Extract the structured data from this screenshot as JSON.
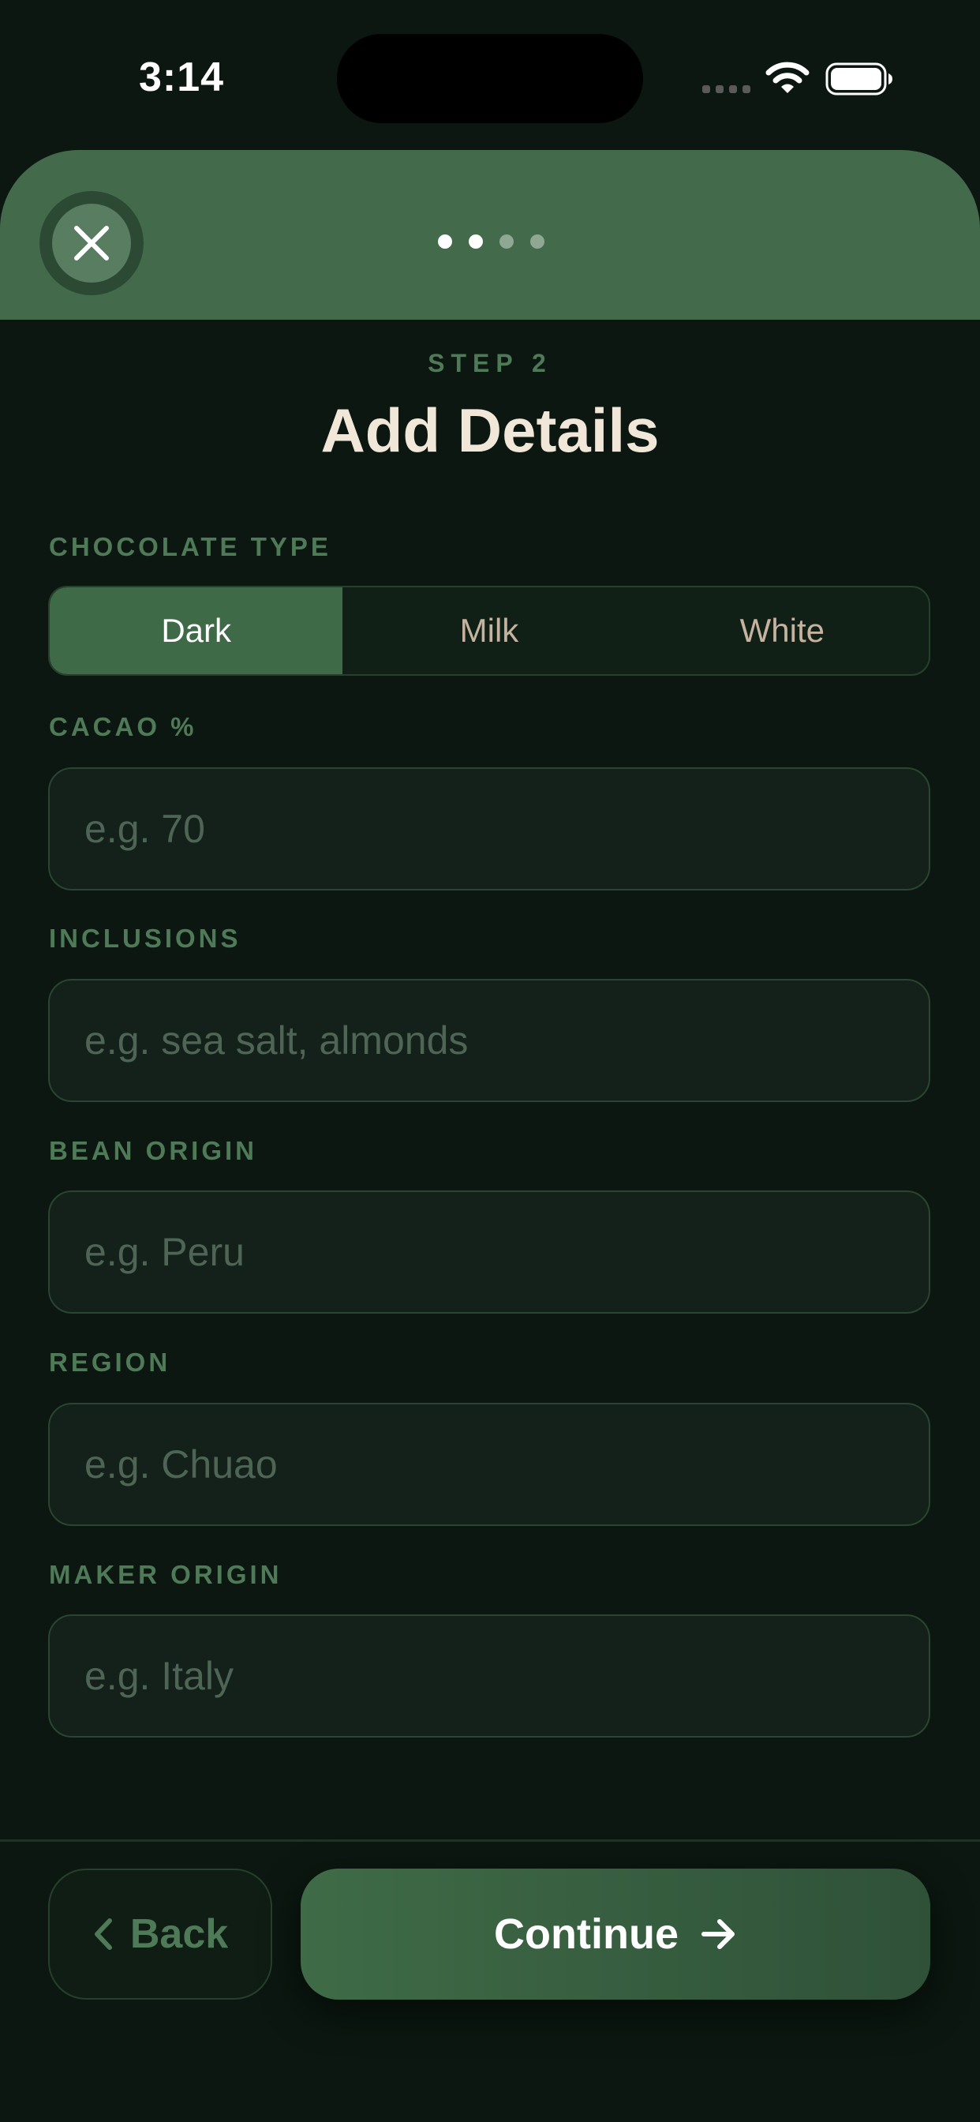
{
  "status_bar": {
    "time": "3:14"
  },
  "header": {
    "close_icon": "close-icon",
    "pager": {
      "total": 4,
      "current": 2
    }
  },
  "step": {
    "label": "STEP 2",
    "title": "Add Details"
  },
  "chocolate_type": {
    "label": "CHOCOLATE TYPE",
    "options": [
      "Dark",
      "Milk",
      "White"
    ],
    "selected": "Dark"
  },
  "fields": {
    "cacao": {
      "label": "CACAO %",
      "placeholder": "e.g. 70",
      "value": ""
    },
    "inclusions": {
      "label": "INCLUSIONS",
      "placeholder": "e.g. sea salt, almonds",
      "value": ""
    },
    "bean_origin": {
      "label": "BEAN ORIGIN",
      "placeholder": "e.g. Peru",
      "value": ""
    },
    "region": {
      "label": "REGION",
      "placeholder": "e.g. Chuao",
      "value": ""
    },
    "maker_origin": {
      "label": "MAKER ORIGIN",
      "placeholder": "e.g. Italy",
      "value": ""
    }
  },
  "footer": {
    "back_label": "Back",
    "back_icon": "chevron-left-icon",
    "continue_label": "Continue",
    "continue_icon": "arrow-right-icon"
  },
  "colors": {
    "background": "#0b1710",
    "accent": "#436b4b",
    "label_green": "#4f7a57",
    "title_cream": "#f1e7d8"
  }
}
